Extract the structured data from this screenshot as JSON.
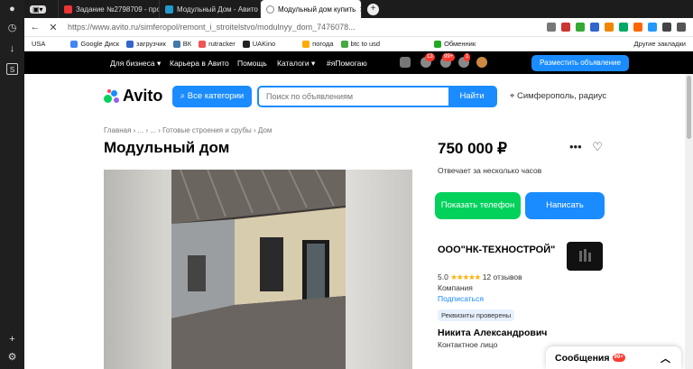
{
  "browser": {
    "tabs": [
      {
        "label": "Задание №2798709 - про",
        "fav_color": "#e33"
      },
      {
        "label": "Модульный Дом - Авито",
        "fav_color": "#29c"
      },
      {
        "label": "Модульный дом купить",
        "fav_color": "#888"
      }
    ],
    "url": "https://www.avito.ru/simferopol/remont_i_stroitelstvo/modulnyy_dom_7476078...",
    "bookmarks": [
      "USA",
      "Google Диск",
      "загрузчик",
      "ВК",
      "rutracker",
      "UAKino",
      "погода",
      "btc to usd",
      "Обменник",
      "Другие закладки"
    ]
  },
  "topbar": {
    "links": [
      "Для бизнеса",
      "Карьера в Авито",
      "Помощь",
      "Каталоги",
      "#яПомогаю"
    ],
    "badge1": "13",
    "badge2": "99+",
    "badge3": "1",
    "post_button": "Разместить объявление"
  },
  "header": {
    "logo": "Avito",
    "categories_button": "Все категории",
    "search_placeholder": "Поиск по объявлениям",
    "search_button": "Найти",
    "location": "Симферополь, радиус"
  },
  "listing": {
    "breadcrumb": "Главная › ... › ... › Готовые строения и срубы › Дом",
    "title": "Модульный дом",
    "price": "750 000 ₽",
    "reply_time": "Отвечает за несколько часов",
    "show_phone": "Показать телефон",
    "write": "Написать"
  },
  "seller": {
    "name": "ООО\"НК-ТЕХНОСТРОЙ\"",
    "rating": "5.0",
    "stars": "★★★★★",
    "reviews": "12 отзывов",
    "type": "Компания",
    "subscribe": "Подписаться",
    "verified": "Реквизиты проверены",
    "contact_name": "Никита Александрович",
    "contact_role": "Контактное лицо"
  },
  "messages": {
    "label": "Сообщения",
    "badge": "99+"
  },
  "colors": {
    "accent": "#1a8cff",
    "green": "#02d15c"
  }
}
